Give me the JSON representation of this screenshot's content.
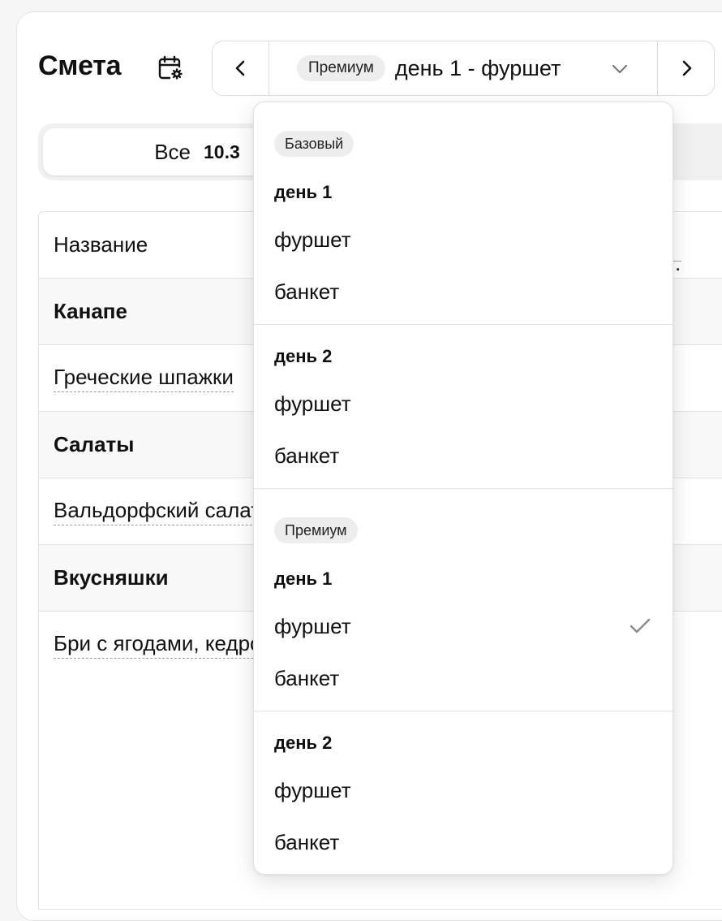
{
  "header": {
    "title": "Смета",
    "selected_tier": "Премиум",
    "selected_label": "день 1 - фуршет"
  },
  "tabs": {
    "active_label": "Все",
    "active_value": "10.3"
  },
  "table": {
    "header_cell": "Название",
    "rows": [
      {
        "type": "category",
        "text": "Канапе"
      },
      {
        "type": "item",
        "text": "Греческие шпажки"
      },
      {
        "type": "category",
        "text": "Салаты"
      },
      {
        "type": "item",
        "text": "Вальдорфский салат"
      },
      {
        "type": "category",
        "text": "Вкусняшки"
      },
      {
        "type": "item",
        "text": "Бри с ягодами, кедровыми"
      }
    ]
  },
  "dropdown": {
    "groups": [
      {
        "tier": "Базовый",
        "days": [
          {
            "day": "день 1",
            "options": [
              "фуршет",
              "банкет"
            ]
          },
          {
            "day": "день 2",
            "options": [
              "фуршет",
              "банкет"
            ]
          }
        ]
      },
      {
        "tier": "Премиум",
        "days": [
          {
            "day": "день 1",
            "options": [
              "фуршет",
              "банкет"
            ]
          },
          {
            "day": "день 2",
            "options": [
              "фуршет",
              "банкет"
            ]
          }
        ]
      }
    ],
    "selected": {
      "tier": "Премиум",
      "day": "день 1",
      "option": "фуршет"
    }
  },
  "icons": {
    "calendar": "calendar-settings-icon",
    "prev": "chevron-left-icon",
    "next": "chevron-right-icon",
    "dropdown": "chevron-down-icon",
    "selected": "check-icon"
  }
}
